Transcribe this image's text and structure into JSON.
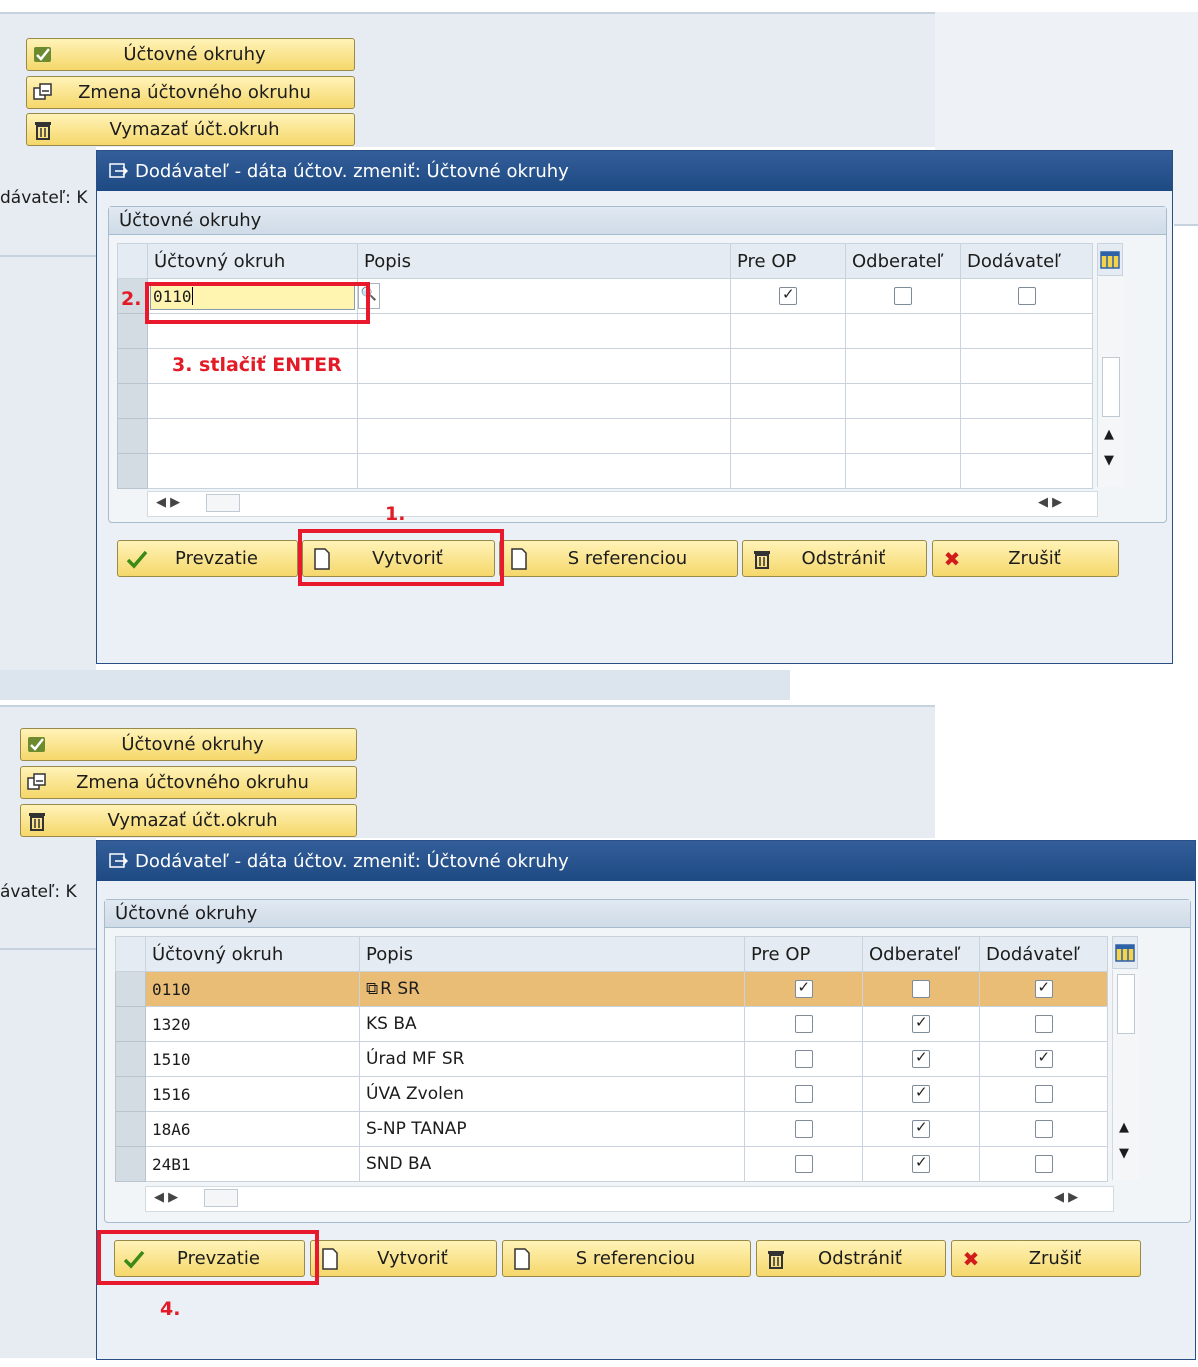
{
  "side_buttons": [
    {
      "label": "Účtovné okruhy"
    },
    {
      "label": "Zmena účtovného okruhu"
    },
    {
      "label": "Vymazať účt.okruh"
    }
  ],
  "background": {
    "partial_label_top": "dávateľ: K",
    "partial_label_bottom": "ávateľ: K"
  },
  "dialog": {
    "title": "Dodávateľ - dáta účtov. zmeniť: Účtovné okruhy",
    "group_title": "Účtovné okruhy",
    "columns": [
      "Účtovný okruh",
      "Popis",
      "Pre OP",
      "Odberateľ",
      "Dodávateľ"
    ],
    "buttons": [
      "Prevzatie",
      "Vytvoriť",
      "S referenciou",
      "Odstrániť",
      "Zrušiť"
    ]
  },
  "top_panel": {
    "input_value": "0110",
    "row": {
      "pre_op": true,
      "odberatel": false,
      "dodavatel": false
    }
  },
  "bottom_panel": {
    "rows": [
      {
        "code": "0110",
        "desc": "R SR",
        "pre_op": true,
        "odberatel": false,
        "dodavatel": true,
        "highlight": true
      },
      {
        "code": "1320",
        "desc": "KS BA",
        "pre_op": false,
        "odberatel": true,
        "dodavatel": false,
        "highlight": false
      },
      {
        "code": "1510",
        "desc": "Úrad MF SR",
        "pre_op": false,
        "odberatel": true,
        "dodavatel": true,
        "highlight": false
      },
      {
        "code": "1516",
        "desc": "ÚVA Zvolen",
        "pre_op": false,
        "odberatel": true,
        "dodavatel": false,
        "highlight": false
      },
      {
        "code": "18A6",
        "desc": "S-NP TANAP",
        "pre_op": false,
        "odberatel": true,
        "dodavatel": false,
        "highlight": false
      },
      {
        "code": "24B1",
        "desc": "SND BA",
        "pre_op": false,
        "odberatel": true,
        "dodavatel": false,
        "highlight": false
      }
    ]
  },
  "annotations": {
    "step1": "1.",
    "step2": "2.",
    "step3": "3. stlačiť ENTER",
    "step4": "4."
  },
  "colors": {
    "annotation_red": "#e21b26",
    "title_blue": "#1e4a84",
    "button_yellow": "#f5d76a",
    "row_highlight": "#e9bd76"
  },
  "icons": {
    "accounting_areas": "check-pencil-icon",
    "change_area": "window-edit-icon",
    "delete_area": "trash-icon",
    "dialog": "dialog-edit-icon",
    "column_settings": "table-settings-icon",
    "search_help": "search-help-icon",
    "accept": "checkmark-icon",
    "create": "document-icon",
    "with_reference": "document-icon",
    "remove": "trash-icon",
    "cancel": "cancel-x-icon"
  }
}
